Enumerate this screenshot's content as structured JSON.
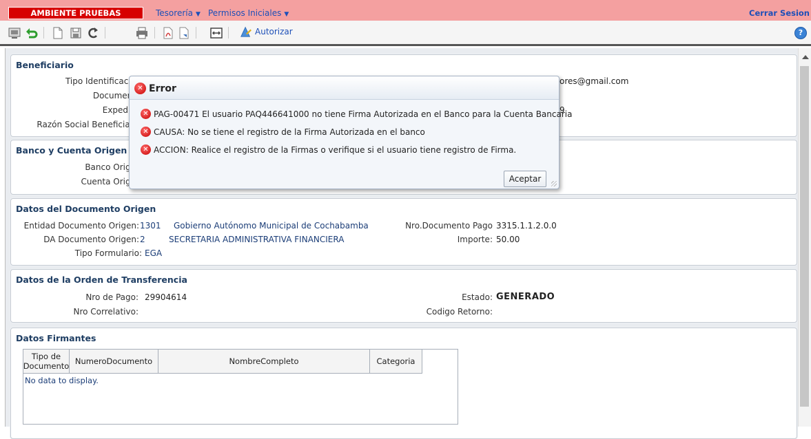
{
  "topbar": {
    "environment": "AMBIENTE PRUEBAS",
    "menu_treasury": "Tesorería",
    "menu_permissions": "Permisos Iniciales",
    "logout": "Cerrar Sesion"
  },
  "toolbar": {
    "authorize": "Autorizar",
    "help": "?",
    "icons": [
      "monitor-icon",
      "undo-icon",
      "new-document-icon",
      "save-icon",
      "redo-icon",
      "print-icon",
      "pdf-icon",
      "export-icon",
      "image-icon",
      "authorize-icon",
      "help-icon"
    ]
  },
  "beneficiario": {
    "title": "Beneficiario",
    "tipo_label": "Tipo Identificació",
    "documento_label": "Document",
    "expedido_label": "Expedid",
    "razon_label": "Razón Social Beneficiari",
    "email_fragment": "ores@gmail.com",
    "hidden_fragment": "9"
  },
  "banco": {
    "title": "Banco y Cuenta Origen",
    "banco_label": "Banco Orige",
    "cuenta_label": "Cuenta Orige"
  },
  "documento": {
    "title": "Datos del Documento Origen",
    "entidad_label": "Entidad Documento Origen:",
    "entidad_code": "1301",
    "entidad_name": "Gobierno Autónomo Municipal de Cochabamba",
    "da_label": "DA Documento Origen:",
    "da_code": "2",
    "da_name": "SECRETARIA ADMINISTRATIVA FINANCIERA",
    "tipo_form_label": "Tipo Formulario:",
    "tipo_form_value": "EGA",
    "nro_doc_label": "Nro.Documento Pago",
    "nro_doc_value": "3315.1.1.2.0.0",
    "importe_label": "Importe:",
    "importe_value": "50.00"
  },
  "orden": {
    "title": "Datos de la Orden de Transferencia",
    "nro_pago_label": "Nro de Pago:",
    "nro_pago_value": "29904614",
    "nro_correlativo_label": "Nro Correlativo:",
    "estado_label": "Estado:",
    "estado_value": "GENERADO",
    "codigo_retorno_label": "Codigo Retorno:"
  },
  "firmantes": {
    "title": "Datos Firmantes",
    "columns": [
      "Tipo de Documento",
      "NumeroDocumento",
      "NombreCompleto",
      "Categoria"
    ],
    "empty_text": "No data to display."
  },
  "dialog": {
    "title": "Error",
    "messages": [
      "PAG-00471 El usuario PAQ446641000 no tiene Firma Autorizada en el Banco para la Cuenta Bancaria",
      "CAUSA: No se tiene el registro de la Firma Autorizada en el banco",
      "ACCION: Realice el registro de la Firmas o verifique si el usuario tiene registro de Firma."
    ],
    "accept": "Aceptar"
  }
}
